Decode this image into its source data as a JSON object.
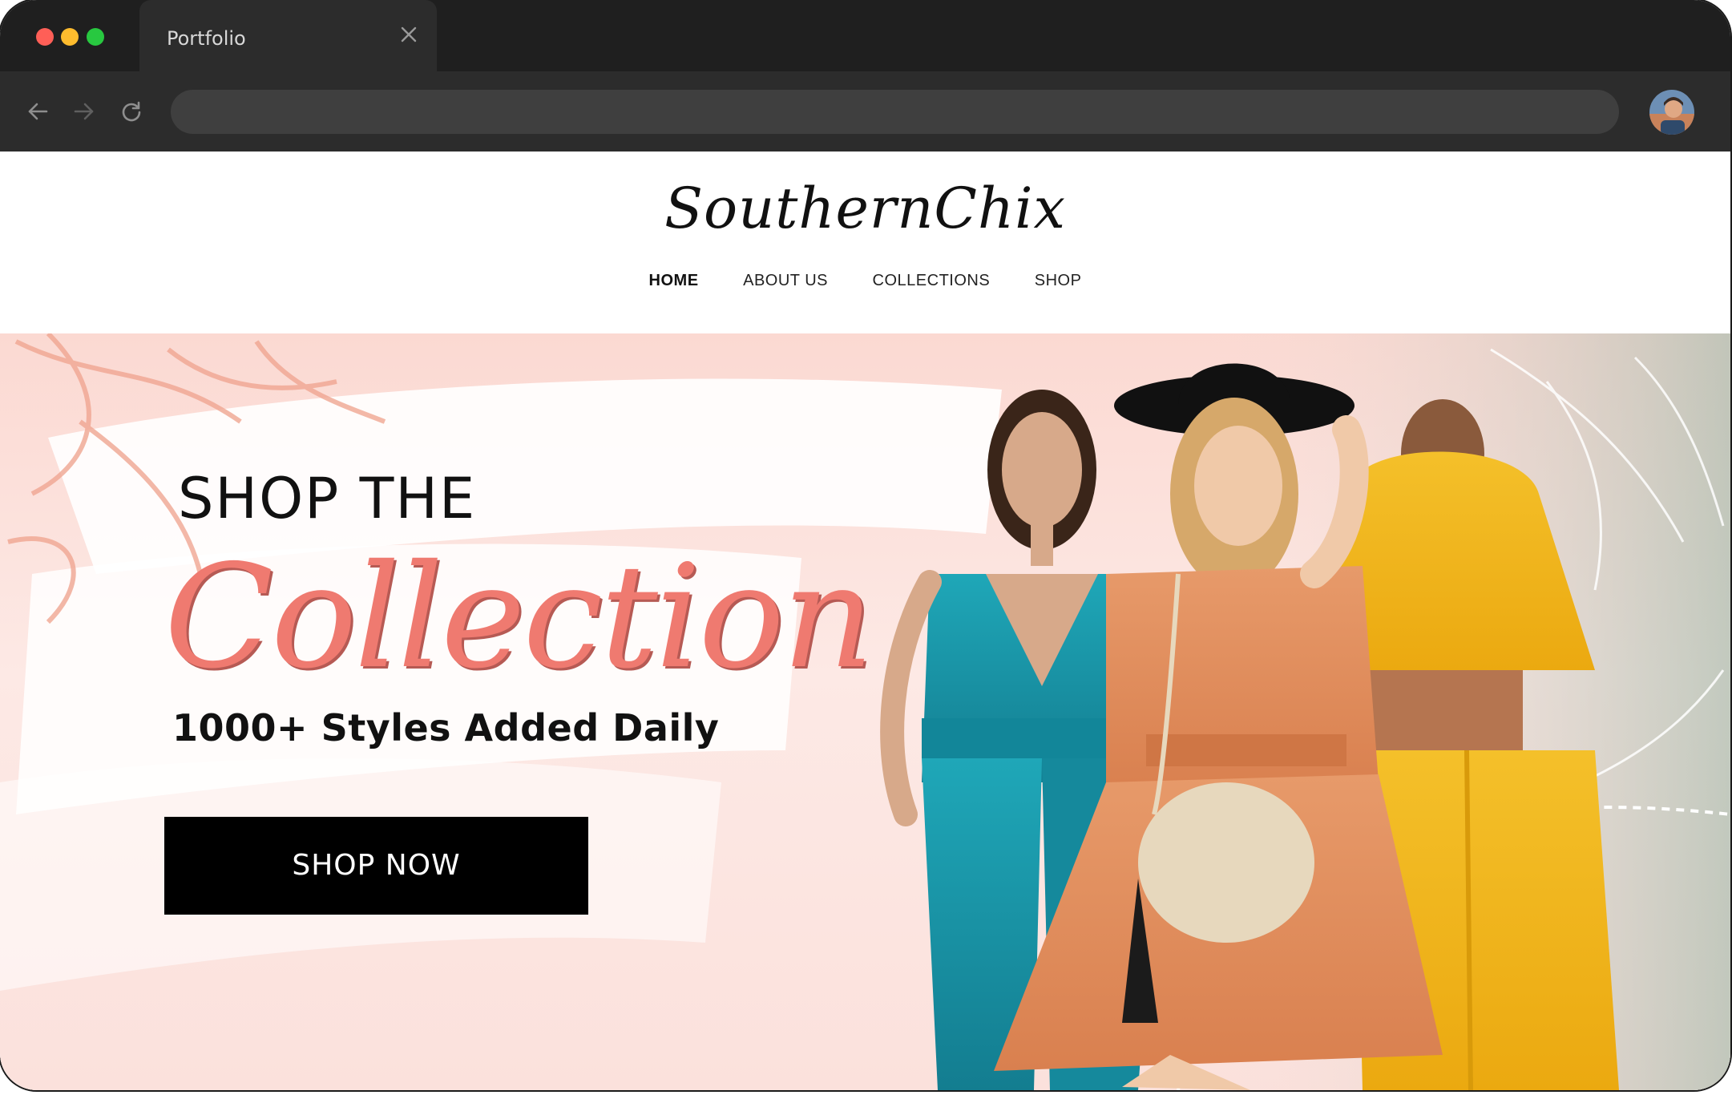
{
  "browser": {
    "tab_title": "Portfolio",
    "address_value": "",
    "icons": {
      "close": "close-icon",
      "back": "back-arrow-icon",
      "forward": "forward-arrow-icon",
      "reload": "reload-icon",
      "avatar": "user-avatar"
    }
  },
  "site": {
    "logo": "SouthernChix",
    "nav": [
      {
        "label": "HOME",
        "active": true
      },
      {
        "label": "ABOUT US",
        "active": false
      },
      {
        "label": "COLLECTIONS",
        "active": false
      },
      {
        "label": "SHOP",
        "active": false
      }
    ],
    "hero": {
      "line1": "SHOP THE",
      "headline": "Collection",
      "subhead": "1000+ Styles Added Daily",
      "cta": "SHOP NOW"
    }
  },
  "colors": {
    "accent": "#ef7a70",
    "hero_bg": "#fbe1dc",
    "cta_bg": "#000000",
    "chrome_bg": "#1f1f1f"
  }
}
